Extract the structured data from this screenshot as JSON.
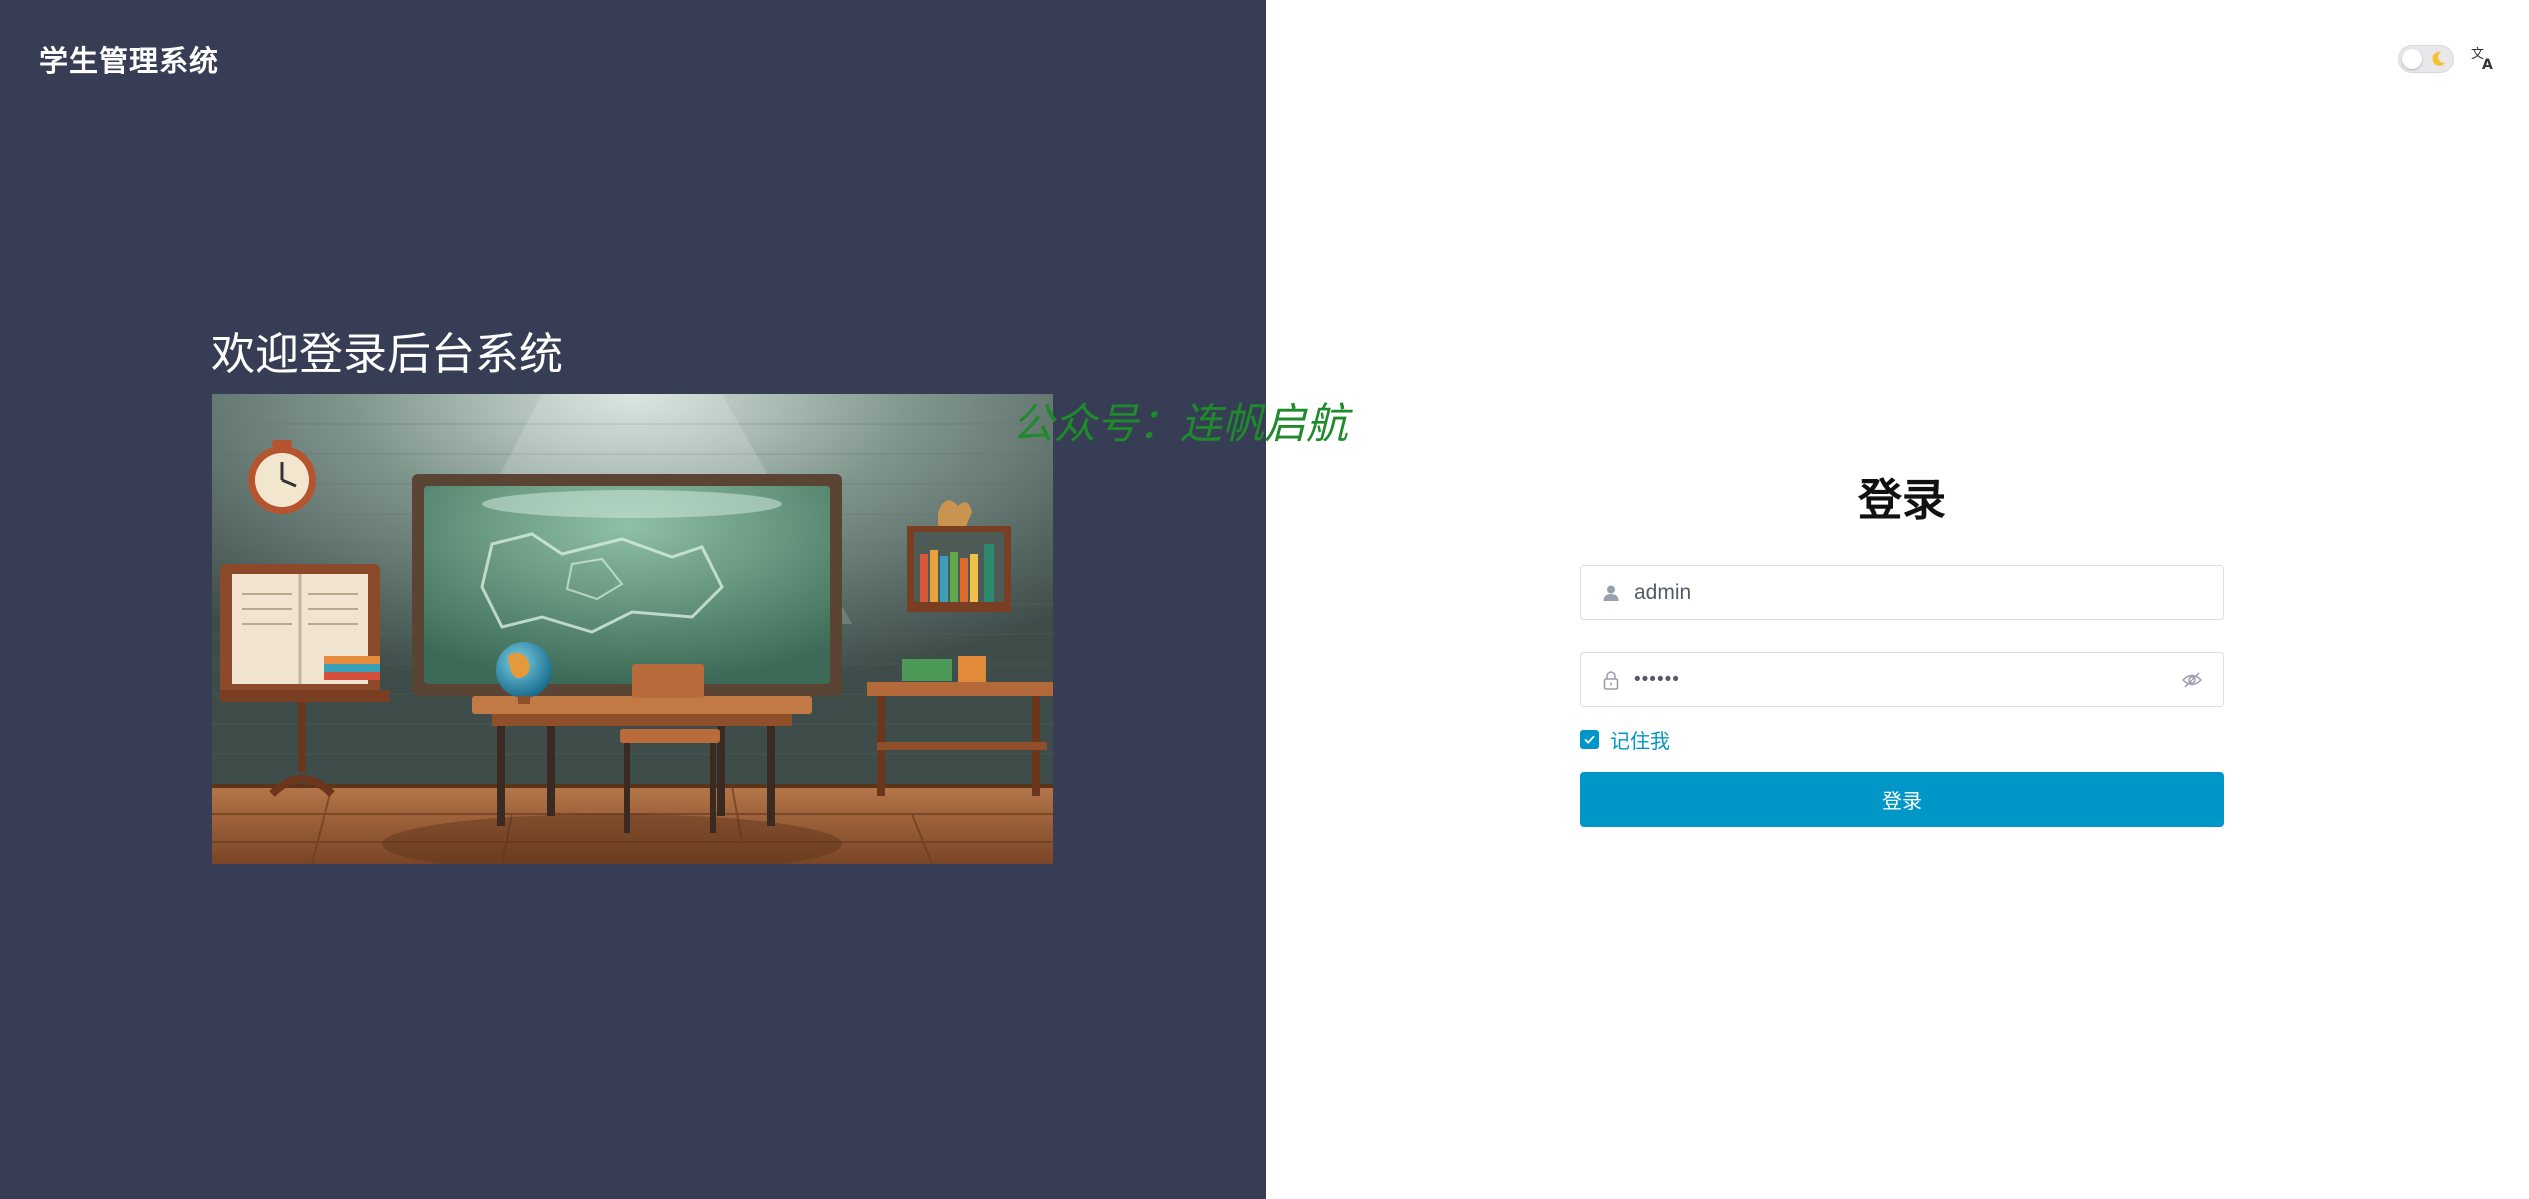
{
  "header": {
    "app_title": "学生管理系统"
  },
  "hero": {
    "welcome_text": "欢迎登录后台系统",
    "watermark": "公众号：连帆启航"
  },
  "topbar": {
    "theme_toggle_state": "light",
    "theme_toggle_icon": "moon-icon",
    "language_icon": "translate-icon"
  },
  "login": {
    "heading": "登录",
    "username": {
      "value": "admin",
      "icon": "user-icon"
    },
    "password": {
      "value": "••••••",
      "icon": "lock-icon",
      "visibility_icon": "eye-off-icon"
    },
    "remember": {
      "label": "记住我",
      "checked": true
    },
    "submit_label": "登录"
  },
  "colors": {
    "left_panel_bg": "#373d55",
    "accent": "#0096c7",
    "watermark": "#1e8a2c"
  }
}
